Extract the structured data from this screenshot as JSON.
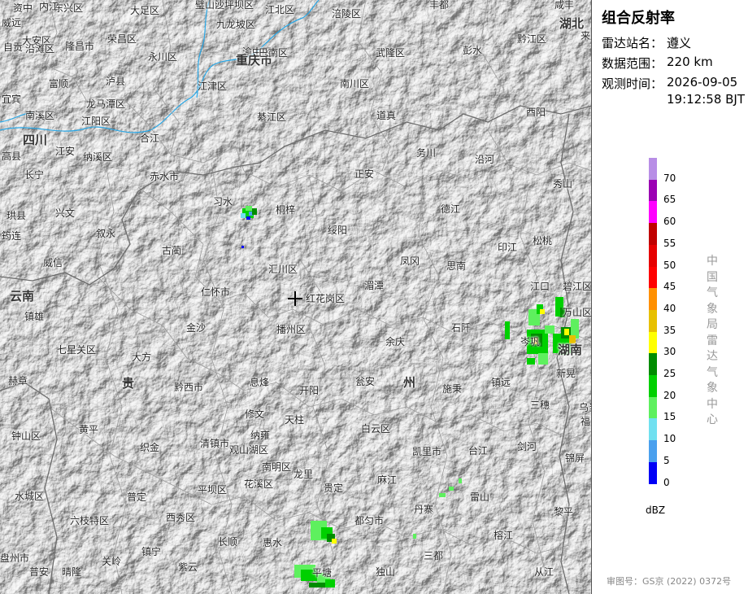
{
  "panel": {
    "title": "组合反射率",
    "station_label": "雷达站名：",
    "station_value": "遵义",
    "range_label": "数据范围：",
    "range_value": "220 km",
    "time_label": "观测时间：",
    "time_date": "2026-09-05",
    "time_clock": "19:12:58 BJT",
    "agency": "中国气象局雷达气象中心",
    "review_number": "审图号：GS京 (2022) 0372号"
  },
  "legend": {
    "unit": "dBZ",
    "levels": [
      {
        "label": "70",
        "color": "#b88ee6"
      },
      {
        "label": "65",
        "color": "#9b00b3"
      },
      {
        "label": "60",
        "color": "#ff00ff"
      },
      {
        "label": "55",
        "color": "#c00000"
      },
      {
        "label": "50",
        "color": "#e60000"
      },
      {
        "label": "45",
        "color": "#ff0000"
      },
      {
        "label": "40",
        "color": "#ff9000"
      },
      {
        "label": "35",
        "color": "#e7c000"
      },
      {
        "label": "30",
        "color": "#ffff00"
      },
      {
        "label": "25",
        "color": "#008c00"
      },
      {
        "label": "20",
        "color": "#00d000"
      },
      {
        "label": "15",
        "color": "#5ef05e"
      },
      {
        "label": "10",
        "color": "#70e0f0"
      },
      {
        "label": "5",
        "color": "#4aa0ee"
      },
      {
        "label": "0",
        "color": "#0000f6"
      }
    ]
  },
  "map": {
    "radar_site_label": "红花岗区",
    "places": [
      "资中",
      "东兴区",
      "大足区",
      "璧山区",
      "沙坪坝区",
      "江北区",
      "涪陵区",
      "丰都",
      "咸丰",
      "威远",
      "内江",
      "大安区",
      "隆昌市",
      "荣昌区",
      "永川区",
      "九龙坡区",
      "渝中区",
      "重庆市",
      "武隆区",
      "彭水",
      "黔江区",
      "湖北",
      "来凤",
      "沿滩区",
      "自贡",
      "富顺",
      "泸县",
      "江津区",
      "巴南区",
      "南川区",
      "宜宾",
      "南溪区",
      "龙马潭区",
      "江阳区",
      "綦江区",
      "道真",
      "酉阳",
      "四川",
      "合江",
      "高县",
      "江安",
      "纳溪区",
      "务川",
      "沿河",
      "长宁",
      "赤水市",
      "正安",
      "秀山",
      "习水",
      "桐梓",
      "德江",
      "珙县",
      "兴文",
      "叙永",
      "绥阳",
      "印江",
      "松桃",
      "筠连",
      "威信",
      "古蔺",
      "凤冈",
      "思南",
      "碧江区",
      "云南",
      "仁怀市",
      "汇川区",
      "湄潭",
      "江口",
      "万山区",
      "镇雄",
      "金沙",
      "播州区",
      "石阡",
      "湖南",
      "七星关区",
      "大方",
      "余庆",
      "岑巩",
      "新晃",
      "赫章",
      "贵",
      "黔西市",
      "息烽",
      "开阳",
      "瓮安",
      "州",
      "施秉",
      "镇远",
      "三穗",
      "修文",
      "乌当区",
      "黄平",
      "天柱",
      "纳雍",
      "白云区",
      "福泉市",
      "钟山区",
      "织金",
      "清镇市",
      "观山湖区",
      "凯里市",
      "台江",
      "剑河",
      "锦屏",
      "南明区",
      "龙里",
      "麻江",
      "水城区",
      "普定",
      "平坝区",
      "花溪区",
      "贵定",
      "雷山",
      "丹寨",
      "黎平",
      "六枝特区",
      "西秀区",
      "都匀市",
      "榕江",
      "长顺",
      "惠水",
      "盘州市",
      "镇宁",
      "三都",
      "关岭",
      "普安",
      "晴隆",
      "紫云",
      "平塘",
      "独山",
      "从江"
    ]
  }
}
